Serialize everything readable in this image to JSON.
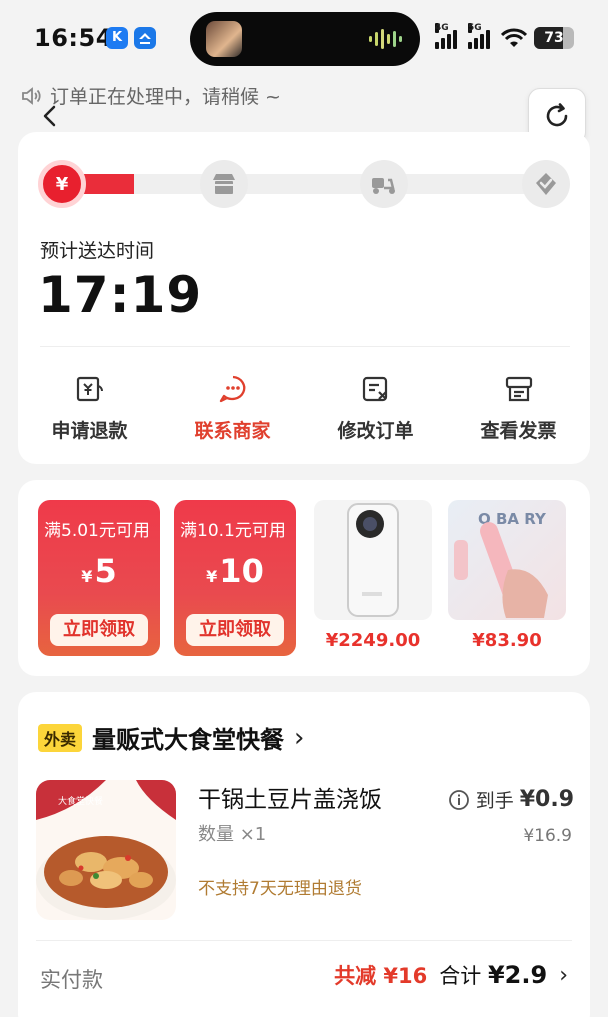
{
  "status_bar": {
    "time": "16:54",
    "app1": "K",
    "net1": "4G",
    "net2": "5G",
    "battery": "73"
  },
  "notice": "订单正在处理中，请稍候 ~",
  "progress": {
    "steps": [
      "¥",
      "",
      "",
      ""
    ],
    "fill_fraction": 0.14
  },
  "eta": {
    "label": "预计送达时间",
    "time": "17:19"
  },
  "actions": [
    {
      "label": "申请退款",
      "icon": "refund-icon"
    },
    {
      "label": "联系商家",
      "icon": "chat-icon"
    },
    {
      "label": "修改订单",
      "icon": "edit-order-icon"
    },
    {
      "label": "查看发票",
      "icon": "invoice-icon"
    }
  ],
  "coupons": [
    {
      "condition": "满5.01元可用",
      "currency": "¥",
      "amount": "5",
      "button": "立即领取"
    },
    {
      "condition": "满10.1元可用",
      "currency": "¥",
      "amount": "10",
      "button": "立即领取"
    }
  ],
  "products": [
    {
      "price": "¥2249.00"
    },
    {
      "price": "¥83.90",
      "img_text": "O BA   RY"
    }
  ],
  "shop": {
    "tag": "外卖",
    "name": "量贩式大食堂快餐",
    "chevron": "›",
    "dish": "干锅土豆片盖浇饭",
    "quantity": "数量 ×1",
    "deal_label": "到手",
    "deal_price": "¥0.9",
    "original_price": "¥16.9",
    "no_refund": "不支持7天无理由退货",
    "pay_label": "实付款",
    "discount": "共减 ¥16",
    "total_label": "合计",
    "total": "¥2.9"
  },
  "colors": {
    "accent": "#e8202e",
    "coupon": "#ef3a4a",
    "tag": "#fcd53a"
  }
}
